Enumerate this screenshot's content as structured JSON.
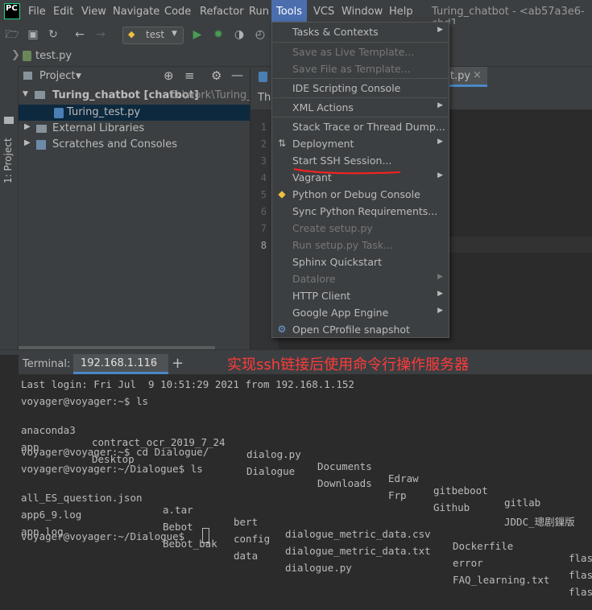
{
  "window": {
    "title": "Turing_chatbot - <ab57a3e6-cbd1"
  },
  "logo_text": "PC",
  "menubar": [
    "File",
    "Edit",
    "View",
    "Navigate",
    "Code",
    "Refactor",
    "Run",
    "Tools",
    "VCS",
    "Window",
    "Help"
  ],
  "toolbar": {
    "run_config": "test"
  },
  "navbar": {
    "file": "test.py"
  },
  "left_stripe": {
    "label": "1: Project"
  },
  "project": {
    "header": "Project",
    "tree": [
      {
        "label": "Turing_chatbot [chatbot]",
        "suffix": " D:\\work\\Turing_"
      },
      {
        "label": "Turing_test.py"
      },
      {
        "label": "External Libraries"
      },
      {
        "label": "Scratches and Consoles"
      }
    ]
  },
  "editor": {
    "tab_label": "test.py",
    "notice_prefix": "The",
    "line_numbers": [
      "1",
      "2",
      "3",
      "4",
      "5",
      "6",
      "7",
      "8"
    ]
  },
  "tools_menu": {
    "items": [
      {
        "label": "Tasks & Contexts",
        "submenu": true,
        "disabled": false
      },
      {
        "label": "Save as Live Template...",
        "submenu": false,
        "disabled": true
      },
      {
        "label": "Save File as Template...",
        "submenu": false,
        "disabled": true
      },
      {
        "label": "IDE Scripting Console",
        "submenu": false,
        "disabled": false
      },
      {
        "label": "XML Actions",
        "submenu": true,
        "disabled": false
      },
      {
        "label": "Stack Trace or Thread Dump...",
        "submenu": false,
        "disabled": false
      },
      {
        "label": "Deployment",
        "submenu": true,
        "disabled": false
      },
      {
        "label": "Start SSH Session...",
        "submenu": false,
        "disabled": false
      },
      {
        "label": "Vagrant",
        "submenu": true,
        "disabled": false
      },
      {
        "label": "Python or Debug Console",
        "submenu": false,
        "disabled": false
      },
      {
        "label": "Sync Python Requirements...",
        "submenu": false,
        "disabled": false
      },
      {
        "label": "Create setup.py",
        "submenu": false,
        "disabled": true
      },
      {
        "label": "Run setup.py Task...",
        "submenu": false,
        "disabled": true
      },
      {
        "label": "Sphinx Quickstart",
        "submenu": false,
        "disabled": false
      },
      {
        "label": "Datalore",
        "submenu": true,
        "disabled": true
      },
      {
        "label": "HTTP Client",
        "submenu": true,
        "disabled": false
      },
      {
        "label": "Google App Engine",
        "submenu": true,
        "disabled": false
      },
      {
        "label": "Open CProfile snapshot",
        "submenu": false,
        "disabled": false
      }
    ]
  },
  "annotation": "实现ssh链接后使用命令行操作服务器",
  "terminal": {
    "label": "Terminal:",
    "tab": "192.168.1.116",
    "add": "+",
    "last_login": "Last login: Fri Jul  9 10:51:29 2021 from 192.168.1.152",
    "prompt1": "voyager@voyager:~$ ls",
    "ls_home": [
      [
        "anaconda3",
        "contract_ocr_2019_7_24",
        "dialog.py",
        "Documents",
        "Edraw",
        "gitbeboot",
        "gitlab"
      ],
      [
        "app",
        "Desktop",
        "",
        "Dialogue",
        "Downloads",
        "Frp",
        "Github",
        "JDDC_璁剧鏁版"
      ]
    ],
    "prompt2": "voyager@voyager:~$ cd Dialogue/",
    "prompt3": "voyager@voyager:~/Dialogue$ ls",
    "ls_dialogue": [
      [
        "all_ES_question.json",
        "a.tar",
        "bert",
        "dialogue_metric_data.csv",
        "Dockerfile",
        "flas"
      ],
      [
        "app6_9.log",
        "Bebot",
        "config",
        "dialogue_metric_data.txt",
        "error",
        "flas"
      ],
      [
        "app.log",
        "Bebot_bak",
        "data",
        "dialogue.py",
        "FAQ_learning.txt",
        "flas"
      ]
    ],
    "prompt4": "voyager@voyager:~/Dialogue$ "
  },
  "colors": {
    "menu_highlight": "#4b6eaf",
    "annotation": "#ff3b3b",
    "run_green": "#499c54",
    "selection": "#0d293e"
  }
}
